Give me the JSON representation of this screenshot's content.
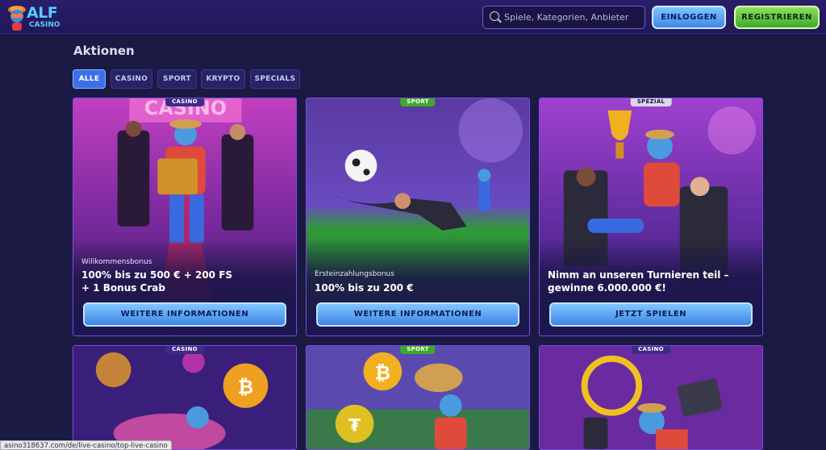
{
  "header": {
    "logo_text": "ALF",
    "logo_sub": "CASINO",
    "search_placeholder": "Spiele, Kategorien, Anbieter",
    "login_label": "EINLOGGEN",
    "register_label": "REGISTRIEREN"
  },
  "page_title": "Aktionen",
  "filters": [
    {
      "label": "ALLE",
      "active": true
    },
    {
      "label": "CASINO",
      "active": false
    },
    {
      "label": "SPORT",
      "active": false
    },
    {
      "label": "KRYPTO",
      "active": false
    },
    {
      "label": "SPECIALS",
      "active": false
    }
  ],
  "cards": [
    {
      "tag": "CASINO",
      "subtitle": "Willkommensbonus",
      "headline_line1": "100% bis zu 500 € + 200 FS",
      "headline_line2": "+ 1 Bonus Crab",
      "button": "WEITERE INFORMATIONEN"
    },
    {
      "tag": "SPORT",
      "subtitle": "Ersteinzahlungsbonus",
      "headline_line1": "100% bis zu 200 €",
      "headline_line2": "",
      "button": "WEITERE INFORMATIONEN"
    },
    {
      "tag": "SPEZIAL",
      "subtitle": "",
      "headline_line1": "Nimm an unseren Turnieren teil –",
      "headline_line2": "gewinne 6.000.000 €!",
      "button": "JETZT SPIELEN"
    },
    {
      "tag": "CASINO"
    },
    {
      "tag": "SPORT"
    },
    {
      "tag": "CASINO"
    }
  ],
  "status_url": "asino318637.com/de/live-casino/top-live-casino"
}
